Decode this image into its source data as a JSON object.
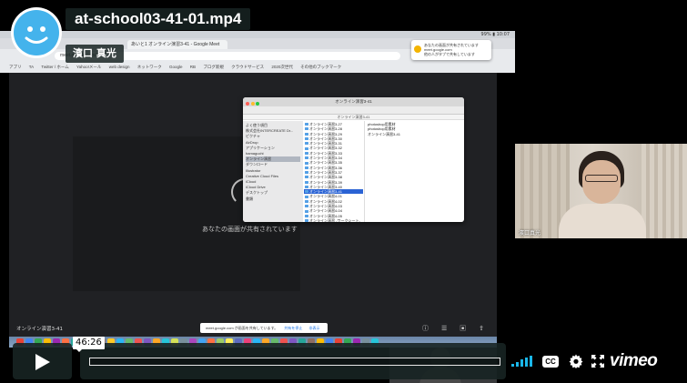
{
  "player": {
    "title": "at-school03-41-01.mp4",
    "owner": "濱口 真光",
    "hover_time": "46:26",
    "brand": "vimeo",
    "cc_label": "CC",
    "accent_color": "#1ab7ea",
    "icons": [
      "play-icon",
      "volume-icon",
      "cc-icon",
      "gear-icon",
      "fullscreen-icon",
      "avatar-face-icon"
    ]
  },
  "recorded_screen": {
    "mac_menubar_right": "99% ▮ 10:07",
    "browser": {
      "tab_label": "あいと1 オンライン演習3-41 - Google Meet",
      "address": "meet.google.com/",
      "bookmarks": [
        "アプリ",
        "TA",
        "Twitter / ホーム",
        "Yahoo!メール",
        "web design",
        "ネットワーク",
        "Google",
        "RB",
        "ブログ新規",
        "クラウドサービス",
        "2020次世代",
        "その他のブックマーク"
      ]
    },
    "notification": {
      "line1": "あなたの画面が共有されています",
      "line2": "meet.google.com",
      "line3": "他の人がタブで共有しています"
    },
    "meet": {
      "sharing_message": "あなたの画面が共有されています",
      "meeting_title": "オンライン演習3-41",
      "banner_text": "meet.google.com が画面を共有しています。",
      "banner_stop": "共有を停止",
      "banner_hide": "非表示"
    },
    "finder": {
      "window_title": "オンライン演習3-41",
      "path_label": "オンライン演習3-41",
      "sidebar": [
        "よく使う項目",
        "株式会社INTERCREATE Dr...",
        "ピクチャ",
        "AirDrop",
        "アプリケーション",
        "hamaguchi",
        "オンライン演習",
        "ダウンロード",
        "Illustrator",
        "Creative Cloud Files",
        "iCloud",
        "iCloud Drive",
        "デスクトップ",
        "書類"
      ],
      "sidebar_selected_index": 6,
      "column1": [
        "オンライン演習3-27",
        "オンライン演習3-28",
        "オンライン演習3-29",
        "オンライン演習3-30",
        "オンライン演習3-31",
        "オンライン演習3-32",
        "オンライン演習3-33",
        "オンライン演習3-34",
        "オンライン演習3-35",
        "オンライン演習3-36",
        "オンライン演習3-37",
        "オンライン演習3-38",
        "オンライン演習3-39",
        "オンライン演習3-40",
        "オンライン演習3-41",
        "オンライン演習4-01",
        "オンライン演習4-02",
        "オンライン演習4-03",
        "オンライン演習4-04",
        "オンライン演習4-05",
        "オンライン演習 -ワークシート-",
        "オンライン演習 -ワークシート-"
      ],
      "column1_selected_index": 14,
      "column2": [
        "photoshop用素材",
        "photoshop用素材",
        "オンライン演習3-41"
      ]
    },
    "dock_colors": [
      "#e94235",
      "#4285f4",
      "#34a853",
      "#fbbc05",
      "#9c27b0",
      "#ff7043",
      "#26a69a",
      "#5c6bc0",
      "#ec407a",
      "#8d6e63",
      "#ffca28",
      "#29b6f6",
      "#66bb6a",
      "#ef5350",
      "#7e57c2",
      "#ffa726",
      "#26c6da",
      "#d4e157",
      "#78909c",
      "#ab47bc",
      "#42a5f5",
      "#ff7043",
      "#9ccc65",
      "#ffee58",
      "#5c6bc0",
      "#ec407a",
      "#29b6f6",
      "#ffa726",
      "#66bb6a",
      "#ef5350",
      "#7e57c2",
      "#26a69a",
      "#8d6e63",
      "#fbbc05",
      "#4285f4",
      "#e94235",
      "#34a853",
      "#9c27b0",
      "#78909c",
      "#26c6da"
    ]
  },
  "camera": {
    "name_label": "濱口真光"
  }
}
